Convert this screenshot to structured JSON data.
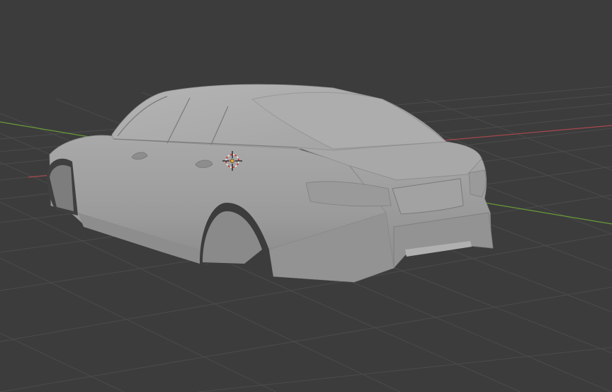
{
  "viewport": {
    "background_color": "#3c3c3c",
    "grid_color": "#4d4d4d",
    "x_axis_color": "#a8474f",
    "y_axis_color": "#6a9a3a",
    "object": "car-body-mesh",
    "object_color": "#9a9a9a",
    "cursor_icon": "3d-cursor-icon",
    "origin_icon": "object-origin-icon"
  }
}
